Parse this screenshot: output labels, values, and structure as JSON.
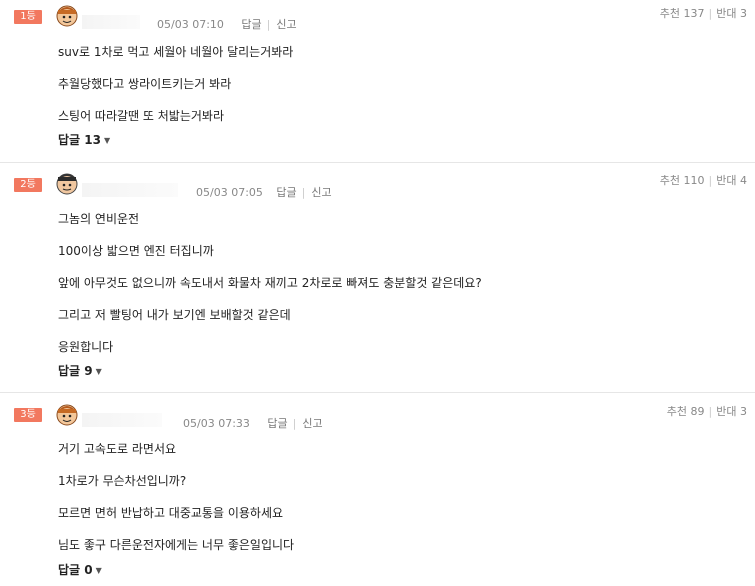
{
  "comments": [
    {
      "rank": "1등",
      "time": "05/03 07:10",
      "reply_btn": "답글",
      "report_btn": "신고",
      "recommend": "추천 137",
      "oppose": "반대 3",
      "lines": [
        "suv로 1차로 먹고 세월아 네월아 달리는거봐라",
        "추월당했다고 쌍라이트키는거 봐라",
        "스팅어 따라갈땐 또 처밟는거봐라"
      ],
      "replies": "답글 13"
    },
    {
      "rank": "2등",
      "time": "05/03 07:05",
      "reply_btn": "답글",
      "report_btn": "신고",
      "recommend": "추천 110",
      "oppose": "반대 4",
      "lines": [
        "그놈의 연비운전",
        "100이상 밟으면 엔진 터집니까",
        "앞에 아무것도 없으니까 속도내서 화물차 재끼고 2차로로 빠져도 충분할것 같은데요?",
        "그리고 저 빨팅어 내가 보기엔 보배할것 같은데",
        "응원합니다"
      ],
      "replies": "답글 9"
    },
    {
      "rank": "3등",
      "time": "05/03 07:33",
      "reply_btn": "답글",
      "report_btn": "신고",
      "recommend": "추천 89",
      "oppose": "반대 3",
      "lines": [
        "거기 고속도로 라면서요",
        "1차로가 무슨차선입니까?",
        "모르면 면허 반납하고 대중교통을 이용하세요",
        "님도 좋구 다른운전자에게는 너무 좋은일입니다"
      ],
      "replies": "답글 0"
    }
  ]
}
